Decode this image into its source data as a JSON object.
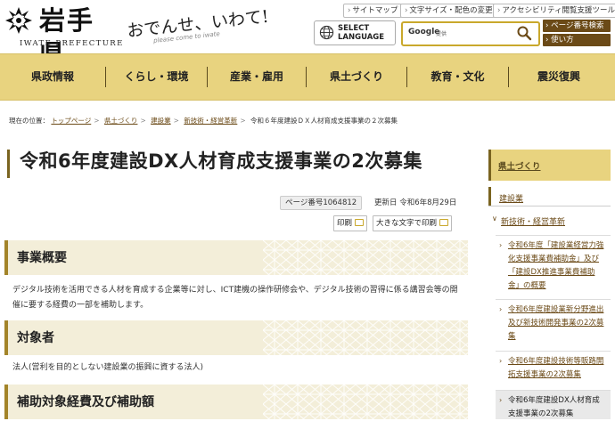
{
  "header": {
    "logo_name": "岩手県",
    "logo_sub": "IWATE PREFECTURE",
    "slogan": "おでんせ、いわて!",
    "slogan_sub": "please come to iwate",
    "util_links": [
      "サイトマップ",
      "文字サイズ・配色の変更",
      "アクセシビリティ閲覧支援ツール"
    ],
    "lang_line1": "SELECT",
    "lang_line2": "LANGUAGE",
    "search_label": "Google",
    "search_sub": "提供",
    "search_value": "",
    "page_search": "ページ番号検索",
    "howto": "使い方"
  },
  "nav": {
    "items": [
      "県政情報",
      "くらし・環境",
      "産業・雇用",
      "県土づくり",
      "教育・文化",
      "震災復興"
    ]
  },
  "breadcrumb": {
    "prefix": "現在の位置：",
    "links": [
      "トップページ",
      "県土づくり",
      "建設業",
      "新技術・経営革新"
    ],
    "current": "令和６年度建設ＤＸ人材育成支援事業の２次募集"
  },
  "page": {
    "title": "令和6年度建設DX人材育成支援事業の2次募集",
    "page_id": "ページ番号1064812",
    "updated": "更新日 令和6年8月29日",
    "print": "印刷",
    "print_large": "大きな文字で印刷"
  },
  "sections": [
    {
      "heading": "事業概要",
      "body": "デジタル技術を活用できる人材を育成する企業等に対し、ICT建機の操作研修会や、デジタル技術の習得に係る講習会等の開催に要する経費の一部を補助します。"
    },
    {
      "heading": "対象者",
      "body": "法人(営利を目的としない建設業の振興に資する法人)"
    },
    {
      "heading": "補助対象経費及び補助額",
      "body": ""
    }
  ],
  "sidebar": {
    "heading": "県土づくり",
    "level1": "建設業",
    "level2": "新技術・経営革新",
    "items": [
      {
        "text": "令和6年度「建設業経営力強化支援事業費補助金」及び「建設DX推進事業費補助金」の概要",
        "current": false
      },
      {
        "text": "令和6年度建設業新分野進出及び新技術開発事業の2次募集",
        "current": false
      },
      {
        "text": "令和6年度建設技術等販路開拓支援事業の2次募集",
        "current": false
      },
      {
        "text": "令和6年度建設DX人材育成支援事業の2次募集",
        "current": true
      }
    ]
  },
  "colors": {
    "accent": "#e8d37f",
    "brown": "#6b4a17",
    "section_bg": "#f3eed9"
  }
}
